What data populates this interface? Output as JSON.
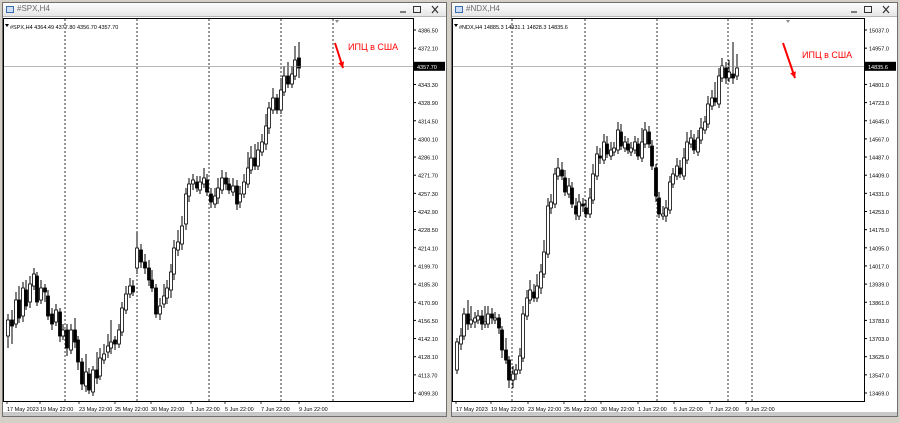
{
  "windows": [
    {
      "title": "#SPX,H4",
      "info_line": "#SPX,H4  4364.49 4377.80 4356.70 4357.70",
      "annotation": "ИПЦ в США",
      "current_price_label": "4357.70",
      "y_ticks": [
        "4386.50",
        "4372.10",
        "4357.70",
        "4343.30",
        "4328.90",
        "4314.50",
        "4300.10",
        "4286.10",
        "4271.70",
        "4257.30",
        "4242.90",
        "4228.50",
        "4214.10",
        "4199.70",
        "4185.30",
        "4170.90",
        "4156.50",
        "4142.10",
        "4128.10",
        "4113.70",
        "4099.30"
      ],
      "x_ticks": [
        "17 May 2023",
        "19 May 22:00",
        "23 May 22:00",
        "25 May 22:00",
        "30 May 22:00",
        "1 Jun 22:00",
        "5 Jun 22:00",
        "7 Jun 22:00",
        "9 Jun 22:00"
      ],
      "colors": {
        "annotation": "#ff0000",
        "bear": "#000000",
        "bull": "#ffffff",
        "grid": "#000000",
        "price_line": "#8c8c8c"
      }
    },
    {
      "title": "#NDX,H4",
      "info_line": "#NDX,H4  14885.3 14931.1 14828.3 14835.6",
      "annotation": "ИПЦ в США",
      "current_price_label": "14835.6",
      "y_ticks": [
        "15037.0",
        "14957.0",
        "14879.0",
        "14801.0",
        "14723.0",
        "14645.0",
        "14567.0",
        "14487.0",
        "14409.0",
        "14331.0",
        "14253.0",
        "14175.0",
        "14095.0",
        "14017.0",
        "13939.0",
        "13861.0",
        "13783.0",
        "13703.0",
        "13625.0",
        "13547.0",
        "13469.0"
      ],
      "x_ticks": [
        "17 May 2023",
        "19 May 22:00",
        "23 May 22:00",
        "25 May 22:00",
        "30 May 22:00",
        "1 Jun 22:00",
        "5 Jun 22:00",
        "7 Jun 22:00",
        "9 Jun 22:00"
      ],
      "colors": {
        "annotation": "#ff0000",
        "bear": "#000000",
        "bull": "#ffffff",
        "grid": "#000000",
        "price_line": "#8c8c8c"
      }
    }
  ]
}
